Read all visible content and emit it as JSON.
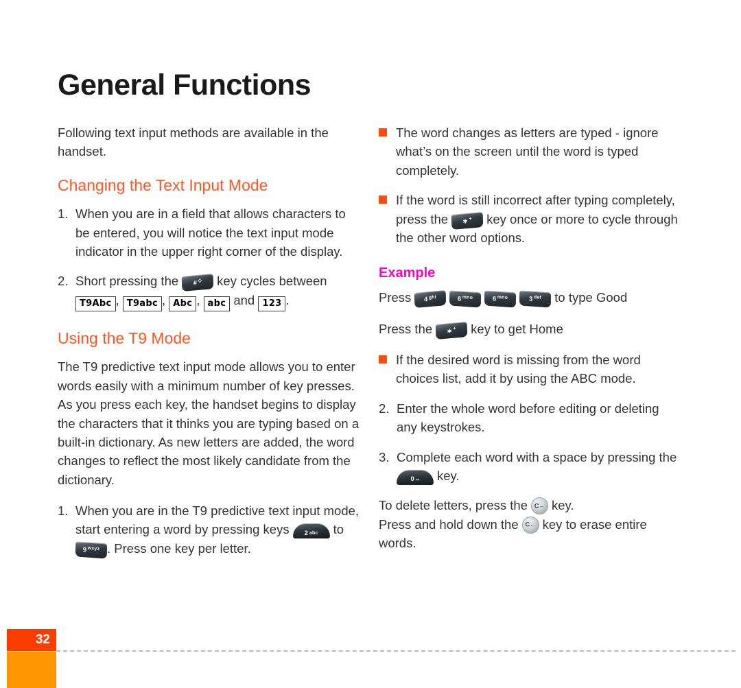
{
  "document": {
    "title": "General Functions",
    "page_number": "32"
  },
  "colors": {
    "heading_orange": "#FF5522",
    "example_magenta": "#FF00C8",
    "bullet_square": "#FF4A10",
    "footer_red": "#F93D00",
    "footer_orange": "#FF9500",
    "body_text": "#333333"
  },
  "left_column": {
    "intro": "Following text input methods are available in the handset.",
    "heading_1": "Changing the Text Input Mode",
    "item_1": {
      "number": "1.",
      "text": "When you are in a field that allows characters to be entered, you will notice the text input mode indicator in the upper right corner of the display."
    },
    "item_2": {
      "number": "2.",
      "text_before": "Short pressing the",
      "text_after": "key cycles between",
      "key": {
        "name": "hash-key",
        "main": "#",
        "sub": "◇"
      },
      "badges": [
        "T9Abc",
        "T9abc",
        "Abc",
        "abc",
        "123"
      ],
      "badge_sep": ",",
      "badge_and": "and",
      "badge_end": "."
    },
    "heading_2": "Using the T9 Mode",
    "paragraph": "The T9 predictive text input mode allows you to enter words easily with a minimum number of key presses. As you press each key, the handset begins to display the characters that it thinks you are typing based on a built-in dictionary. As new letters are added, the word changes to reflect the most likely candidate from the dictionary.",
    "item_3": {
      "number": "1.",
      "text_a": "When you are in the T9 predictive text input mode, start entering a word by pressing keys",
      "text_b": "to",
      "text_c": ". Press one key per letter.",
      "key_from": {
        "name": "key-2-abc",
        "main": "2",
        "sub": "abc"
      },
      "key_to": {
        "name": "key-9-wxyz",
        "main": "9",
        "sub": "wxyz"
      }
    }
  },
  "right_column": {
    "bullet_1": "The word changes as letters are typed - ignore what’s on the screen until the word is typed completely.",
    "bullet_2": {
      "text_before": "If the word is still incorrect after typing completely, press the",
      "text_after": "key once or more to cycle through the other word options.",
      "key": {
        "name": "star-key",
        "main": "∗",
        "sub": "+"
      }
    },
    "example_heading": "Example",
    "example_line_1": {
      "text_before": "Press",
      "text_after": "to type Good",
      "keys": [
        {
          "name": "key-4-ghi",
          "main": "4",
          "sub": "ghi"
        },
        {
          "name": "key-6-mno",
          "main": "6",
          "sub": "mno"
        },
        {
          "name": "key-6-mno",
          "main": "6",
          "sub": "mno"
        },
        {
          "name": "key-3-def",
          "main": "3",
          "sub": "def"
        }
      ]
    },
    "example_line_2": {
      "text_before": "Press the",
      "text_after": "key to get Home",
      "key": {
        "name": "star-key",
        "main": "∗",
        "sub": "+"
      }
    },
    "bullet_3": "If the desired word is missing from the word choices list, add it by using the ABC mode.",
    "item_2": {
      "number": "2.",
      "text": "Enter the whole word before editing or deleting any keystrokes."
    },
    "item_3": {
      "number": "3.",
      "text_before": "Complete each word with a space by pressing the",
      "text_after": "key.",
      "key": {
        "name": "key-0-space",
        "main": "0",
        "sub": "⌴"
      }
    },
    "closing_1": {
      "text_before": "To delete letters, press the",
      "text_after": "key.",
      "key": {
        "name": "clear-key",
        "label": "C←"
      }
    },
    "closing_2": {
      "text_before": "Press and hold down the",
      "text_after": "key to erase entire words.",
      "key": {
        "name": "clear-key",
        "label": "C←"
      }
    }
  }
}
